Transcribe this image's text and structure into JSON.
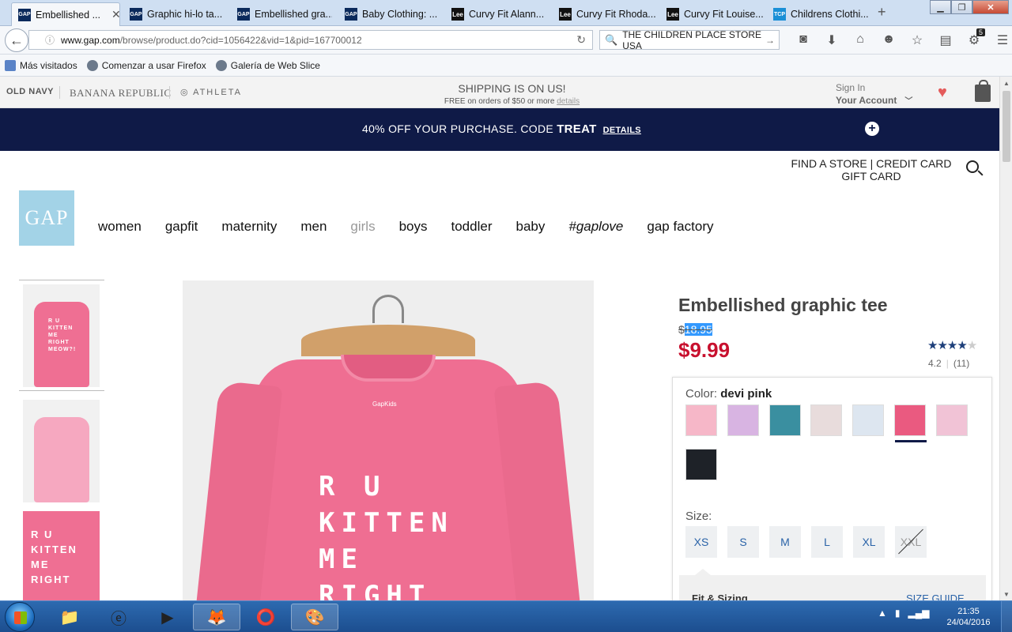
{
  "browser": {
    "tabs": [
      {
        "label": "Embellished ...",
        "icon": "gap-favicon",
        "active": true
      },
      {
        "label": "Graphic hi-lo ta...",
        "icon": "gap-favicon"
      },
      {
        "label": "Embellished gra...",
        "icon": "gap-favicon"
      },
      {
        "label": "Baby Clothing: ...",
        "icon": "gap-favicon"
      },
      {
        "label": "Curvy Fit Alann...",
        "icon": "lee-favicon"
      },
      {
        "label": "Curvy Fit Rhoda...",
        "icon": "lee-favicon"
      },
      {
        "label": "Curvy Fit Louise...",
        "icon": "lee-favicon"
      },
      {
        "label": "Childrens Clothi...",
        "icon": "tcp-favicon"
      }
    ],
    "url_host": "www.gap.com",
    "url_path": "/browse/product.do?cid=1056422&vid=1&pid=167700012",
    "search_value": "THE CHILDREN PLACE  STORE USA",
    "badge_count": "5",
    "bookmarks": [
      "Más visitados",
      "Comenzar a usar Firefox",
      "Galería de Web Slice"
    ]
  },
  "site": {
    "brands": [
      "OLD NAVY",
      "BANANA REPUBLIC",
      "ATHLETA"
    ],
    "shipping_title": "SHIPPING IS ON US!",
    "shipping_sub": "FREE on orders of $50 or more",
    "shipping_link": "details",
    "signin": "Sign In",
    "account": "Your Account",
    "promo_text": "40% OFF YOUR PURCHASE. CODE ",
    "promo_code": "TREAT",
    "promo_details": "DETAILS",
    "find_store": "FIND A STORE | CREDIT CARD",
    "gift_card": "GIFT CARD",
    "logo_text": "GAP",
    "nav": [
      "women",
      "gapfit",
      "maternity",
      "men",
      "girls",
      "boys",
      "toddler",
      "baby",
      "#gaplove",
      "gap factory"
    ]
  },
  "product": {
    "title": "Embellished graphic tee",
    "old_price_symbol": "$",
    "old_price_value": "18.95",
    "new_price": "$9.99",
    "rating_value": "4.2",
    "review_count": "(11)",
    "rating_stars": 4.2,
    "main_image_words": [
      "R U",
      "KITTEN",
      "ME",
      "RIGHT"
    ],
    "tee_label": "GapKids",
    "thumb_words": [
      "R U",
      "KITTEN",
      "ME",
      "RIGHT",
      "MEOW?!"
    ],
    "color_label": "Color:",
    "color_value": "devi pink",
    "swatch_colors": [
      "#f6b7c8",
      "#d8b4e2",
      "#3a8fa0",
      "#e8dcdc",
      "#dde6f0",
      "#ea5a80",
      "#f1c3d6",
      "#1e2228"
    ],
    "size_label": "Size:",
    "sizes": [
      {
        "label": "XS",
        "available": true
      },
      {
        "label": "S",
        "available": true
      },
      {
        "label": "M",
        "available": true
      },
      {
        "label": "L",
        "available": true
      },
      {
        "label": "XL",
        "available": true
      },
      {
        "label": "XXL",
        "available": false
      }
    ],
    "fit_label": "Fit & Sizing",
    "size_guide": "SIZE GUIDE"
  },
  "taskbar": {
    "time": "21:35",
    "date": "24/04/2016"
  }
}
